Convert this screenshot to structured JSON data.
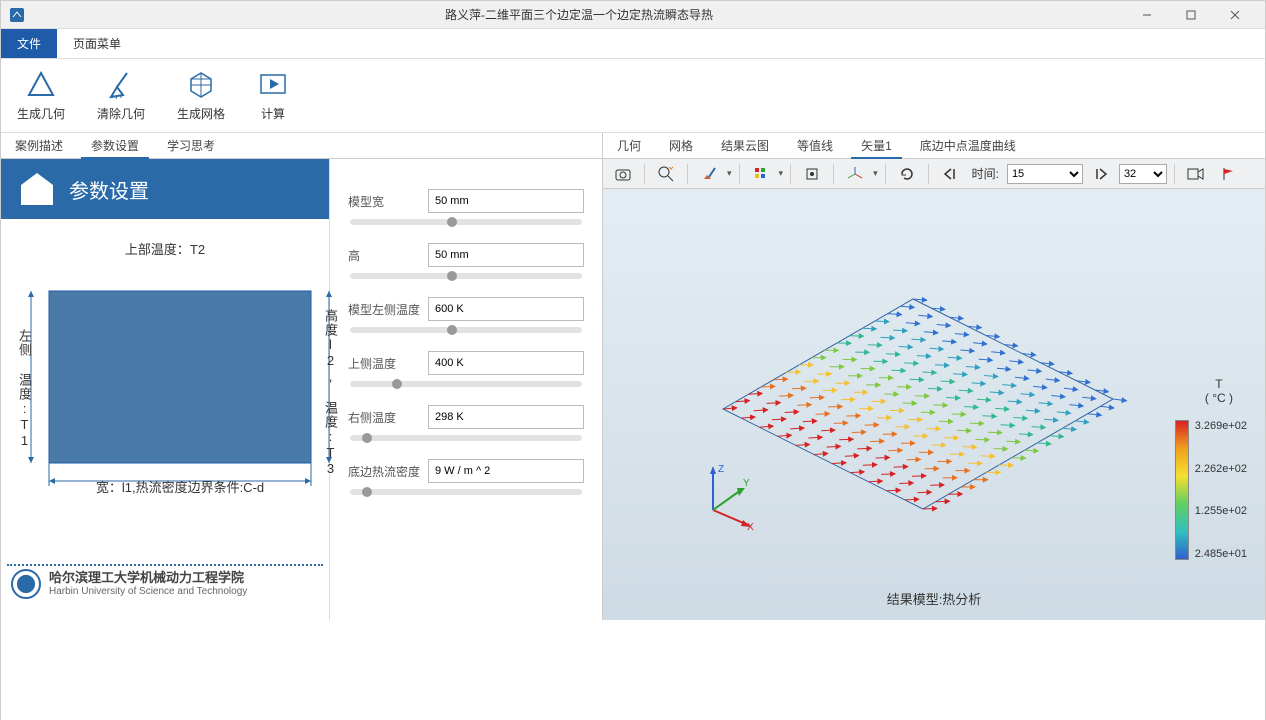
{
  "window": {
    "title": "路义萍-二维平面三个边定温一个边定热流瞬态导热"
  },
  "menu": {
    "file": "文件",
    "page_menu": "页面菜单"
  },
  "ribbon": {
    "gen_geometry": "生成几何",
    "clear_geometry": "清除几何",
    "gen_mesh": "生成网格",
    "compute": "计算"
  },
  "left_tabs": {
    "case_desc": "案例描述",
    "param_set": "参数设置",
    "study": "学习思考"
  },
  "right_tabs": {
    "geometry": "几何",
    "mesh": "网格",
    "result_cloud": "结果云图",
    "isoline": "等值线",
    "vector1": "矢量1",
    "bottom_curve": "底边中点温度曲线"
  },
  "panel": {
    "header": "参数设置"
  },
  "diagram": {
    "top": "上部温度：T2",
    "left": "左侧 温度:T1",
    "right": "高度l2, 温度:T3",
    "bottom": "宽：l1,热流密度边界条件:C-d"
  },
  "uni": {
    "cn": "哈尔滨理工大学机械动力工程学院",
    "en": "Harbin University of Science and Technology"
  },
  "params": {
    "model_width": {
      "label": "模型宽",
      "value": "50 mm",
      "thumb": 42
    },
    "height": {
      "label": "高",
      "value": "50 mm",
      "thumb": 42
    },
    "left_temp": {
      "label": "模型左侧温度",
      "value": "600 K",
      "thumb": 42
    },
    "top_temp": {
      "label": "上侧温度",
      "value": "400 K",
      "thumb": 18
    },
    "right_temp": {
      "label": "右侧温度",
      "value": "298 K",
      "thumb": 5
    },
    "bottom_flux": {
      "label": "底边热流密度",
      "value": "9 W / m ^ 2",
      "thumb": 5
    }
  },
  "toolbar3d": {
    "time_label": "时间:",
    "time_value": "15",
    "frame_value": "32"
  },
  "legend": {
    "title_sym": "T",
    "title_unit": "( °C )",
    "v0": "3.269e+02",
    "v1": "2.262e+02",
    "v2": "1.255e+02",
    "v3": "2.485e+01"
  },
  "result": {
    "label": "结果模型:热分析"
  },
  "axes": {
    "x": "X",
    "y": "Y",
    "z": "Z"
  }
}
